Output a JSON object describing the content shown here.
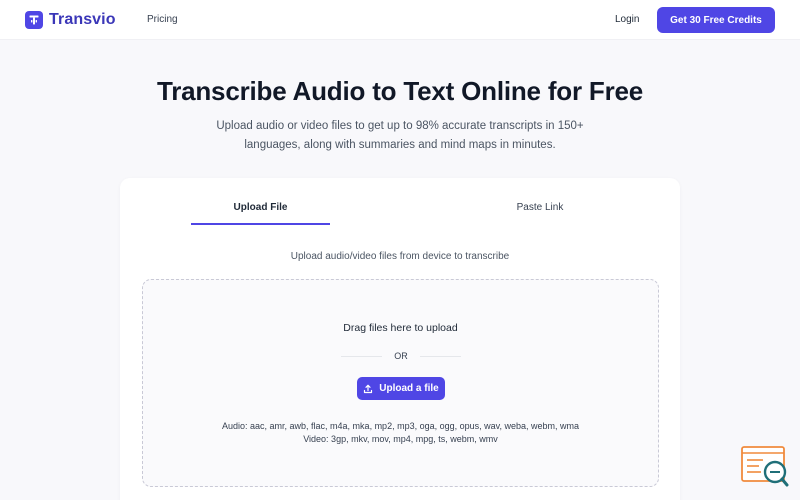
{
  "navbar": {
    "brand": "Transvio",
    "links": [
      {
        "label": "Pricing"
      }
    ],
    "login_label": "Login",
    "cta_label": "Get 30 Free Credits"
  },
  "hero": {
    "title": "Transcribe Audio to Text Online for Free",
    "subtitle": "Upload audio or video files to get up to 98% accurate transcripts in 150+ languages, along with summaries and mind maps in minutes."
  },
  "card": {
    "tabs": [
      {
        "label": "Upload File",
        "active": true
      },
      {
        "label": "Paste Link",
        "active": false
      }
    ],
    "hint": "Upload audio/video files from device to transcribe",
    "dropzone": {
      "drag_text": "Drag files here to upload",
      "or_text": "OR",
      "button_label": "Upload a file",
      "audio_formats": "Audio: aac, amr, awb, flac, m4a, mka, mp2, mp3, oga, ogg, opus, wav, weba, webm, wma",
      "video_formats": "Video: 3gp, mkv, mov, mp4, mpg, ts, webm, wmv"
    }
  },
  "icons": {
    "logo": "transvio-logo-icon",
    "upload": "upload-icon",
    "widget": "support-chat-icon"
  },
  "colors": {
    "accent": "#4f46e5",
    "background": "#f8f8fb",
    "widget_orange": "#f08a3c",
    "widget_teal": "#1f6f78"
  }
}
